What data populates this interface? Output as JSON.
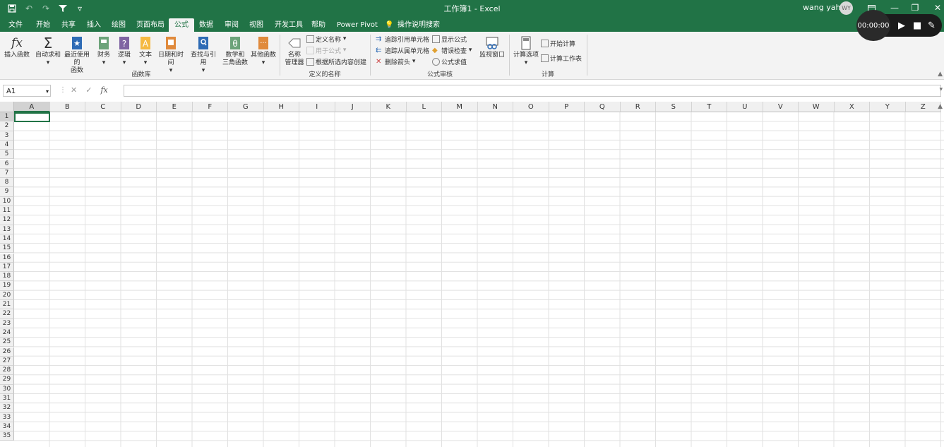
{
  "qat": {
    "save": "save-icon",
    "undo": "undo-icon",
    "redo": "redo-icon",
    "filter": "filter-icon",
    "customize": "▿"
  },
  "title": "工作簿1 - Excel",
  "user": {
    "name": "wang yahui",
    "initials": "WY"
  },
  "tabs": [
    "文件",
    "开始",
    "共享",
    "插入",
    "绘图",
    "页面布局",
    "公式",
    "数据",
    "审阅",
    "视图",
    "开发工具",
    "帮助",
    "Power Pivot",
    "操作说明搜索"
  ],
  "active_tab": "公式",
  "ribbon": {
    "func_lib": {
      "insert": "插入函数",
      "autosum": "自动求和",
      "recent": "最近使用的",
      "recent2": "函数",
      "finance": "财务",
      "logic": "逻辑",
      "text": "文本",
      "datetime": "日期和时间",
      "lookup": "查找与引用",
      "math1": "数学和",
      "math2": "三角函数",
      "other": "其他函数",
      "group": "函数库"
    },
    "names": {
      "manager1": "名称",
      "manager2": "管理器",
      "define": "定义名称",
      "use": "用于公式",
      "create": "根据所选内容创建",
      "group": "定义的名称"
    },
    "audit": {
      "trace_prec": "追踪引用单元格",
      "trace_dep": "追踪从属单元格",
      "remove": "删除箭头",
      "show": "显示公式",
      "error": "错误检查",
      "eval": "公式求值",
      "watch": "监视窗口",
      "group": "公式审核"
    },
    "calc": {
      "options": "计算选项",
      "calc_now": "开始计算",
      "calc_sheet": "计算工作表",
      "group": "计算"
    }
  },
  "formula_bar": {
    "name_box": "A1",
    "fx": "fx",
    "value": ""
  },
  "recorder": {
    "time": "00:00:00"
  },
  "columns": [
    "A",
    "B",
    "C",
    "D",
    "E",
    "F",
    "G",
    "H",
    "I",
    "J",
    "K",
    "L",
    "M",
    "N",
    "O",
    "P",
    "Q",
    "R",
    "S",
    "T",
    "U",
    "V",
    "W",
    "X",
    "Y",
    "Z"
  ],
  "rows": [
    "1",
    "2",
    "3",
    "4",
    "5",
    "6",
    "7",
    "8",
    "9",
    "10",
    "11",
    "12",
    "13",
    "14",
    "15",
    "16",
    "17",
    "18",
    "19",
    "20",
    "21",
    "22",
    "23",
    "24",
    "25",
    "26",
    "27",
    "28",
    "29",
    "30",
    "31",
    "32",
    "33",
    "34",
    "35"
  ]
}
